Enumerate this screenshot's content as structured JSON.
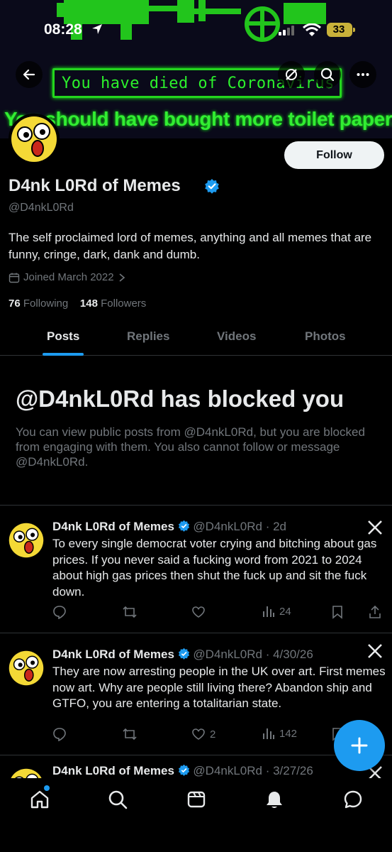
{
  "status_bar": {
    "time": "08:28",
    "battery": "33"
  },
  "banner": {
    "box_text": "You have died of Coronavirus",
    "caption": "You should have bought more toilet paper."
  },
  "profile": {
    "follow_label": "Follow",
    "display_name": "D4nk L0Rd of Memes",
    "handle": "@D4nkL0Rd",
    "bio": "The self proclaimed lord of memes, anything and all memes that are funny, cringe, dark, dank and dumb.",
    "joined": "Joined March 2022",
    "following_count": "76",
    "following_label": "Following",
    "followers_count": "148",
    "followers_label": "Followers"
  },
  "tabs": [
    {
      "label": "Posts"
    },
    {
      "label": "Replies"
    },
    {
      "label": "Videos"
    },
    {
      "label": "Photos"
    }
  ],
  "blocked": {
    "title": "@D4nkL0Rd has blocked you",
    "text": "You can view public posts from @D4nkL0Rd, but you are blocked from engaging with them. You also cannot follow or message @D4nkL0Rd."
  },
  "posts": [
    {
      "name": "D4nk L0Rd of Memes",
      "meta": "@D4nkL0Rd · 2d",
      "text": "To every single democrat voter crying and bitching about gas prices. If you never said a fucking word from 2021 to 2024 about high gas prices then shut the fuck up and sit the fuck down.",
      "likes": "",
      "views": "24"
    },
    {
      "name": "D4nk L0Rd of Memes",
      "meta": "@D4nkL0Rd · 4/30/26",
      "text": "They are now arresting people in the UK over art. First memes now art. Why are people still living there? Abandon ship and GTFO, you are entering a totalitarian state.",
      "likes": "2",
      "views": "142"
    },
    {
      "name": "D4nk L0Rd of Memes",
      "meta": "@D4nkL0Rd · 3/27/26",
      "text": "",
      "likes": "",
      "views": ""
    }
  ],
  "colors": {
    "accent": "#1d9bf0",
    "banner_green": "#2cf02c",
    "muted": "#71767b"
  }
}
